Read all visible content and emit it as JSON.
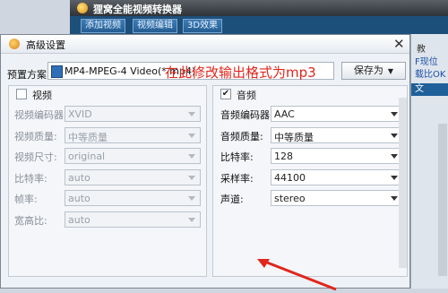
{
  "background_app": {
    "title": "狸窝全能视频转换器",
    "tabs": [
      "添加视频",
      "视频编辑",
      "3D效果"
    ],
    "right_panel": {
      "label1": "教",
      "label2": "F现位",
      "label3": "载比OK",
      "strip": "文"
    }
  },
  "dialog": {
    "title": "高级设置",
    "preset_label": "预置方案:",
    "preset_value": "MP4-MPEG-4 Video(*.mp4)",
    "annotation": "在此修改输出格式为mp3",
    "save_as": "保存为",
    "video": {
      "title": "视频",
      "checked": false,
      "rows": [
        {
          "label": "视频编码器:",
          "value": "XVID"
        },
        {
          "label": "视频质量:",
          "value": "中等质量"
        },
        {
          "label": "视频尺寸:",
          "value": "original"
        },
        {
          "label": "比特率:",
          "value": "auto"
        },
        {
          "label": "帧率:",
          "value": "auto"
        },
        {
          "label": "宽高比:",
          "value": "auto"
        }
      ]
    },
    "audio": {
      "title": "音频",
      "checked": true,
      "rows": [
        {
          "label": "音频编码器:",
          "value": "AAC"
        },
        {
          "label": "音频质量:",
          "value": "中等质量"
        },
        {
          "label": "比特率:",
          "value": "128"
        },
        {
          "label": "采样率:",
          "value": "44100"
        },
        {
          "label": "声道:",
          "value": "stereo"
        }
      ]
    }
  },
  "colors": {
    "annotation": "#e0261d",
    "toolbar": "#1d4f7b"
  }
}
